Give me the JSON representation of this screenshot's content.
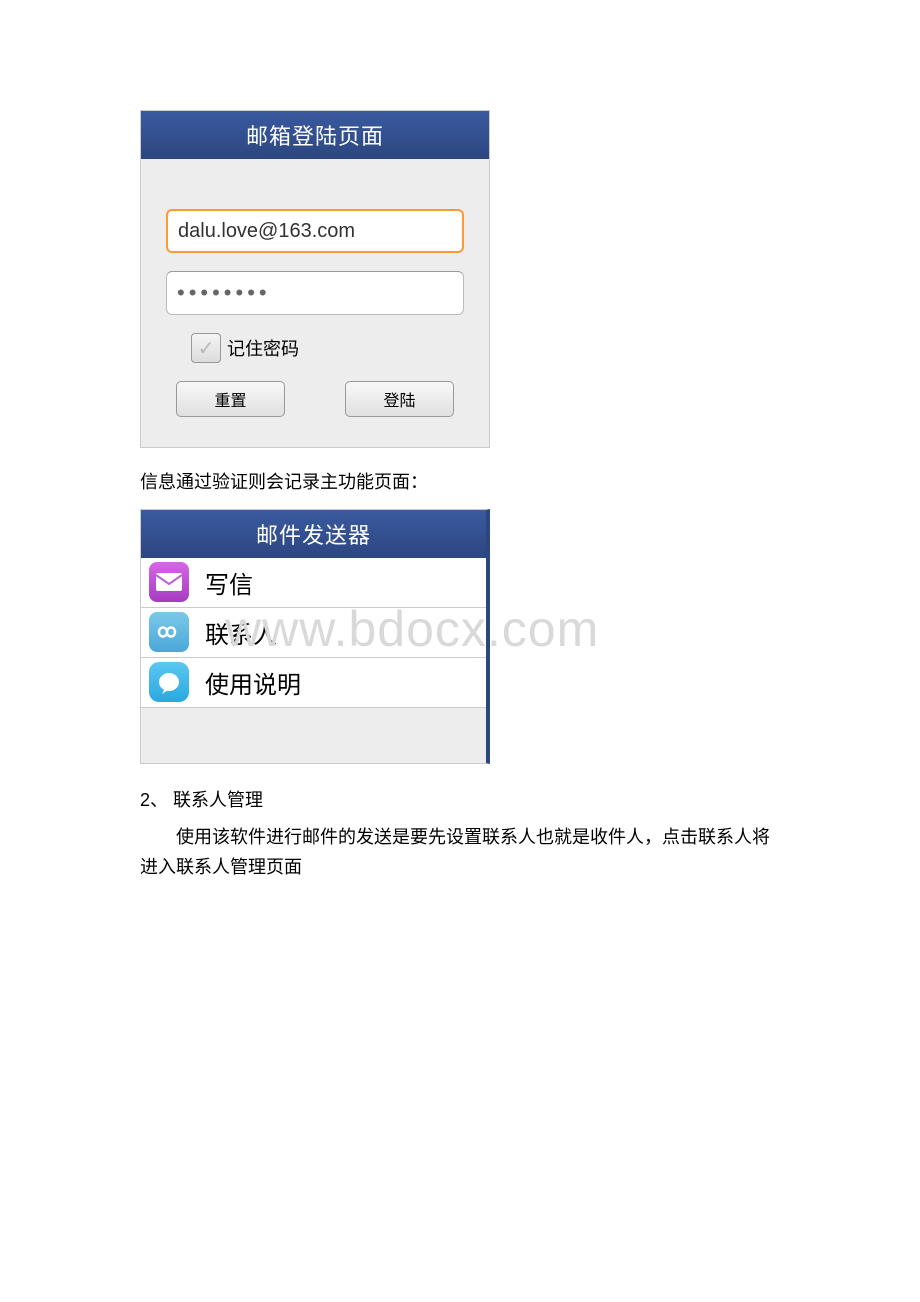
{
  "watermark": "www.bdocx.com",
  "login": {
    "title": "邮箱登陆页面",
    "email_value": "dalu.love@163.com",
    "password_value": "••••••••",
    "remember_label": "记住密码",
    "reset_label": "重置",
    "submit_label": "登陆"
  },
  "doc_text_1": "信息通过验证则会记录主功能页面：",
  "main_menu": {
    "title": "邮件发送器",
    "items": [
      {
        "label": "写信"
      },
      {
        "label": "联系人"
      },
      {
        "label": "使用说明"
      }
    ]
  },
  "section_heading": "2、 联系人管理",
  "paragraph": "使用该软件进行邮件的发送是要先设置联系人也就是收件人，点击联系人将进入联系人管理页面"
}
